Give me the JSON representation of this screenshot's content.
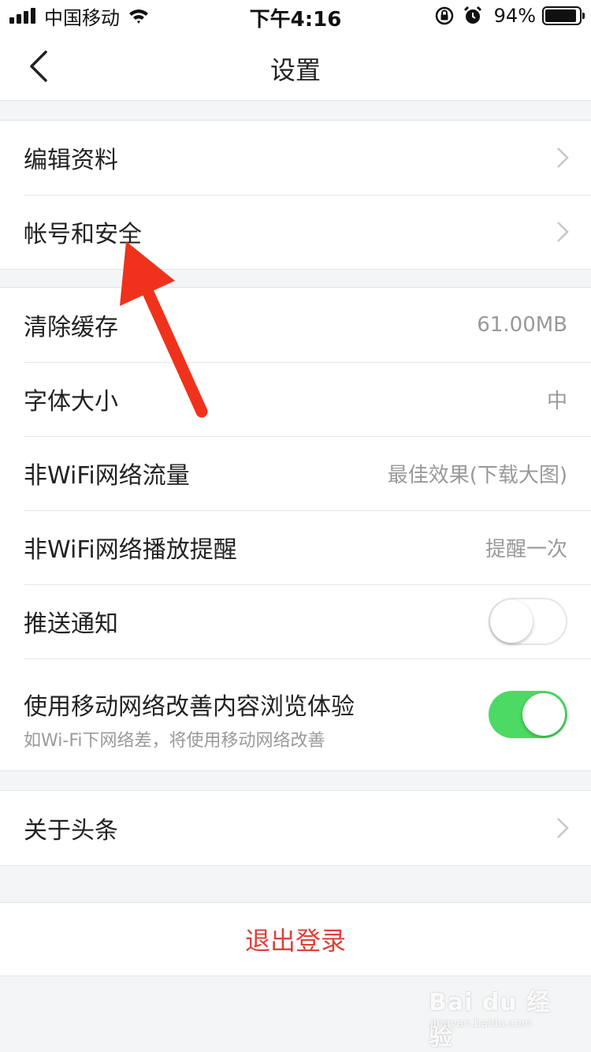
{
  "status_bar": {
    "carrier": "中国移动",
    "time": "下午4:16",
    "battery_percent": "94%",
    "battery_level": 0.94,
    "icons": [
      "signal-icon",
      "wifi-icon",
      "rotation-lock-icon",
      "alarm-icon",
      "battery-icon"
    ]
  },
  "nav": {
    "title": "设置",
    "back_icon": "chevron-left-icon"
  },
  "groups": [
    {
      "rows": [
        {
          "label": "编辑资料",
          "chevron": true
        },
        {
          "label": "帐号和安全",
          "chevron": true
        }
      ]
    },
    {
      "rows": [
        {
          "label": "清除缓存",
          "value": "61.00MB"
        },
        {
          "label": "字体大小",
          "value": "中"
        },
        {
          "label": "非WiFi网络流量",
          "value": "最佳效果(下载大图)"
        },
        {
          "label": "非WiFi网络播放提醒",
          "value": "提醒一次"
        },
        {
          "label": "推送通知",
          "toggle": false
        },
        {
          "label": "使用移动网络改善内容浏览体验",
          "sub": "如Wi-Fi下网络差，将使用移动网络改善",
          "toggle": true
        }
      ]
    },
    {
      "rows": [
        {
          "label": "关于头条",
          "chevron": true
        }
      ]
    }
  ],
  "logout_label": "退出登录",
  "watermark": {
    "brand": "Bai du 经验",
    "url": "jingyan.baidu.com"
  },
  "colors": {
    "background": "#f4f5f6",
    "accent_red": "#e0403a",
    "toggle_on": "#4cd964",
    "annotation_arrow": "#f0321c"
  }
}
